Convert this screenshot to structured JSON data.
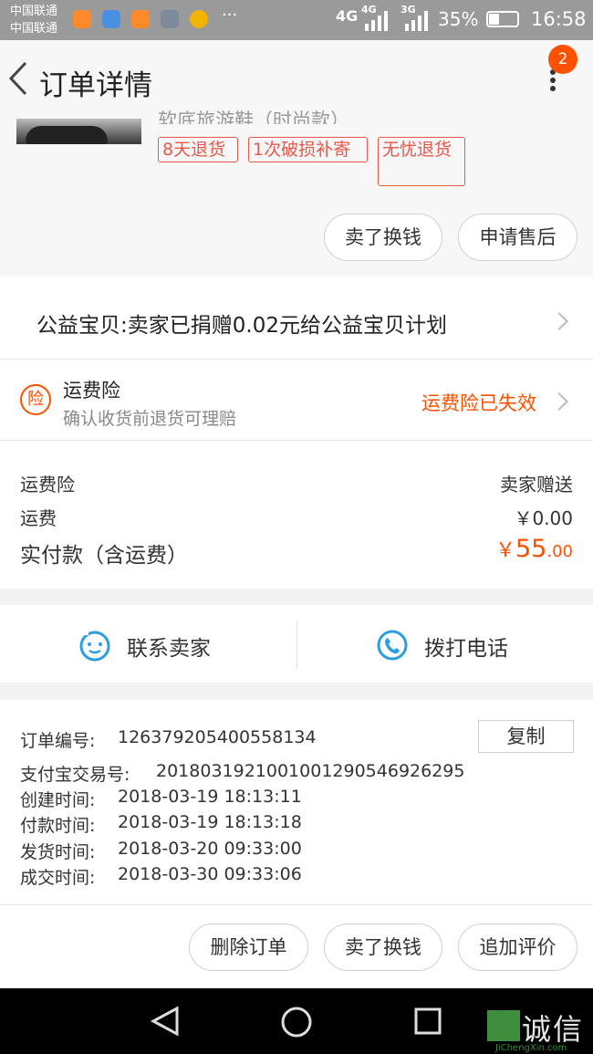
{
  "status_bar": {
    "carrier1": "中国联通",
    "carrier2": "中国联通",
    "more": "···",
    "net1": "4G",
    "net2": "4G",
    "net3": "3G",
    "battery": "35%",
    "time": "16:58"
  },
  "header": {
    "title": "订单详情",
    "notification_count": "2"
  },
  "product": {
    "name_partial": "软底旅游鞋（时尚款）",
    "tags": [
      "8天退货",
      "1次破损补寄",
      "无忧退货"
    ],
    "buttons": [
      "卖了换钱",
      "申请售后"
    ]
  },
  "charity": {
    "text": "公益宝贝:卖家已捐赠0.02元给公益宝贝计划"
  },
  "insurance": {
    "icon_char": "险",
    "title": "运费险",
    "subtitle": "确认收货前退货可理赔",
    "status": "运费险已失效"
  },
  "payment": {
    "rows": [
      {
        "label": "运费险",
        "value": "卖家赠送"
      },
      {
        "label": "运费",
        "value": "￥0.00"
      }
    ],
    "total_label": "实付款（含运费）",
    "total_symbol": "￥",
    "total_int": "55",
    "total_dec": ".00"
  },
  "contact": {
    "seller": "联系卖家",
    "phone": "拨打电话"
  },
  "order_info": {
    "copy_label": "复制",
    "rows": [
      {
        "label": "订单编号:",
        "value": "126379205400558134"
      },
      {
        "label": "支付宝交易号:",
        "value": "2018031921001001290546926295"
      },
      {
        "label": "创建时间:",
        "value": "2018-03-19 18:13:11"
      },
      {
        "label": "付款时间:",
        "value": "2018-03-19 18:13:18"
      },
      {
        "label": "发货时间:",
        "value": "2018-03-20 09:33:00"
      },
      {
        "label": "成交时间:",
        "value": "2018-03-30 09:33:06"
      }
    ]
  },
  "actions": {
    "delete": "删除订单",
    "sell": "卖了换钱",
    "review": "追加评价"
  },
  "watermark": {
    "brand": "诚信",
    "url": "JiChengXin.com"
  },
  "colors": {
    "accent": "#ff5000",
    "tag_red": "#e8574a",
    "blue_icon": "#2d9de0"
  }
}
